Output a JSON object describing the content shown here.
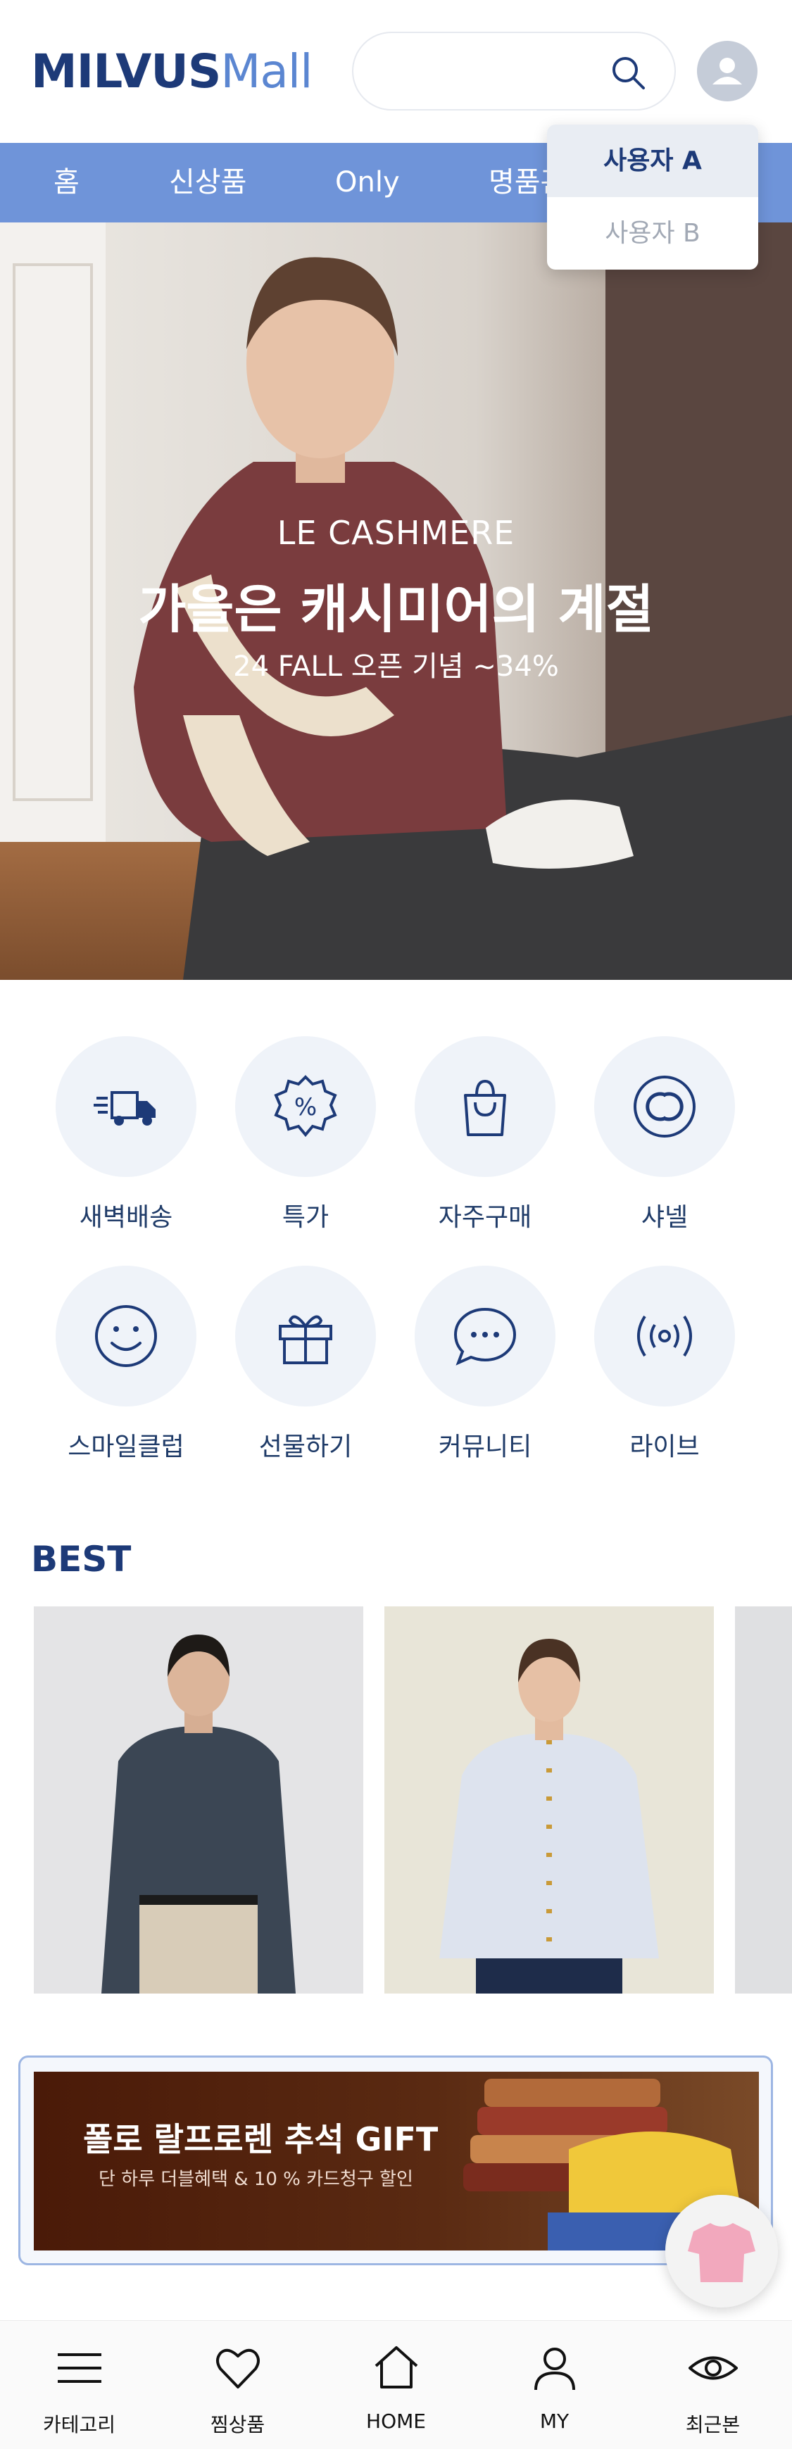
{
  "header": {
    "logo_primary": "MILVUS",
    "logo_secondary": "Mall",
    "search_placeholder": "",
    "search_icon": "search-icon",
    "avatar_icon": "user-icon"
  },
  "user_menu": {
    "items": [
      {
        "label": "사용자 A",
        "selected": true
      },
      {
        "label": "사용자 B",
        "selected": false
      }
    ]
  },
  "nav": {
    "items": [
      {
        "label": "홈"
      },
      {
        "label": "신상품"
      },
      {
        "label": "Only"
      },
      {
        "label": "명품관"
      }
    ]
  },
  "hero": {
    "brand": "LE CASHMERE",
    "title": "가을은 캐시미어의 계절",
    "caption": "24 FALL 오픈 기념 ~34%"
  },
  "categories": [
    {
      "label": "새벽배송",
      "icon": "truck-icon"
    },
    {
      "label": "특가",
      "icon": "discount-badge-icon"
    },
    {
      "label": "자주구매",
      "icon": "shopping-bag-icon"
    },
    {
      "label": "샤넬",
      "icon": "chanel-logo-icon"
    },
    {
      "label": "스마일클럽",
      "icon": "smile-icon"
    },
    {
      "label": "선물하기",
      "icon": "gift-icon"
    },
    {
      "label": "커뮤니티",
      "icon": "chat-bubble-icon"
    },
    {
      "label": "라이브",
      "icon": "live-broadcast-icon"
    }
  ],
  "best": {
    "title": "BEST"
  },
  "banner": {
    "title": "폴로 랄프로렌 추석 GIFT",
    "subtitle": "단 하루 더블혜택 & 10 % 카드청구 할인"
  },
  "bottom_nav": {
    "items": [
      {
        "label": "카테고리",
        "icon": "menu-icon"
      },
      {
        "label": "찜상품",
        "icon": "heart-icon"
      },
      {
        "label": "HOME",
        "icon": "home-icon"
      },
      {
        "label": "MY",
        "icon": "user-icon"
      },
      {
        "label": "최근본",
        "icon": "eye-icon"
      }
    ]
  },
  "colors": {
    "brand_navy": "#1d3a78",
    "brand_blue": "#5b86d1",
    "nav_bar": "#6f94d9",
    "category_bg": "#eff3f9"
  }
}
